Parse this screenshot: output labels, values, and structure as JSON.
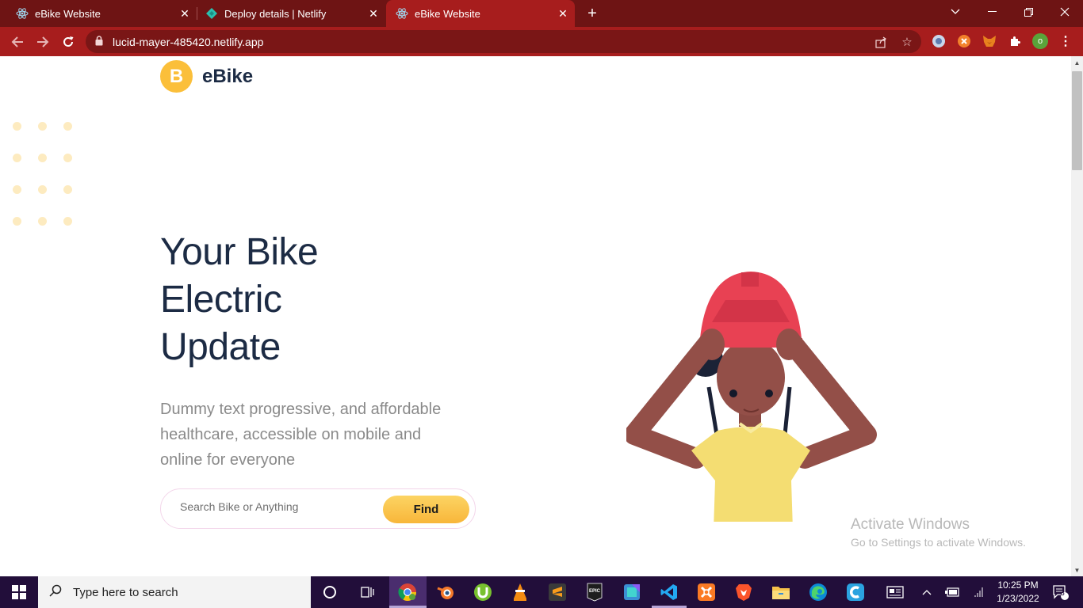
{
  "browser": {
    "tabs": [
      {
        "title": "eBike Website",
        "active": false
      },
      {
        "title": "Deploy details | Netlify",
        "active": false
      },
      {
        "title": "eBike Website",
        "active": true
      }
    ],
    "url": "lucid-mayer-485420.netlify.app",
    "profile_initial": "o",
    "theme_color": "#a71d1d"
  },
  "page": {
    "logo_letter": "B",
    "brand": "eBike",
    "hero_title_lines": [
      "Your Bike",
      "Electric",
      "Update"
    ],
    "hero_subtitle": "Dummy text progressive, and affordable healthcare, accessible on mobile and online for everyone",
    "search_placeholder": "Search Bike or Anything",
    "find_label": "Find",
    "accent_color": "#fbbf3a",
    "title_color": "#1c2b44"
  },
  "watermark": {
    "title": "Activate Windows",
    "subtitle": "Go to Settings to activate Windows."
  },
  "taskbar": {
    "search_placeholder": "Type here to search",
    "time": "10:25 PM",
    "date": "1/23/2022",
    "notification_count": "3",
    "pinned_apps": [
      "cortana-icon",
      "task-view-icon",
      "chrome-icon",
      "blender-icon",
      "utorrent-icon",
      "vlc-icon",
      "sublime-text-icon",
      "epic-games-icon",
      "generic-app-icon",
      "vscode-icon",
      "xampp-icon",
      "brave-icon",
      "file-explorer-icon",
      "edge-icon",
      "ccleaner-icon"
    ]
  }
}
